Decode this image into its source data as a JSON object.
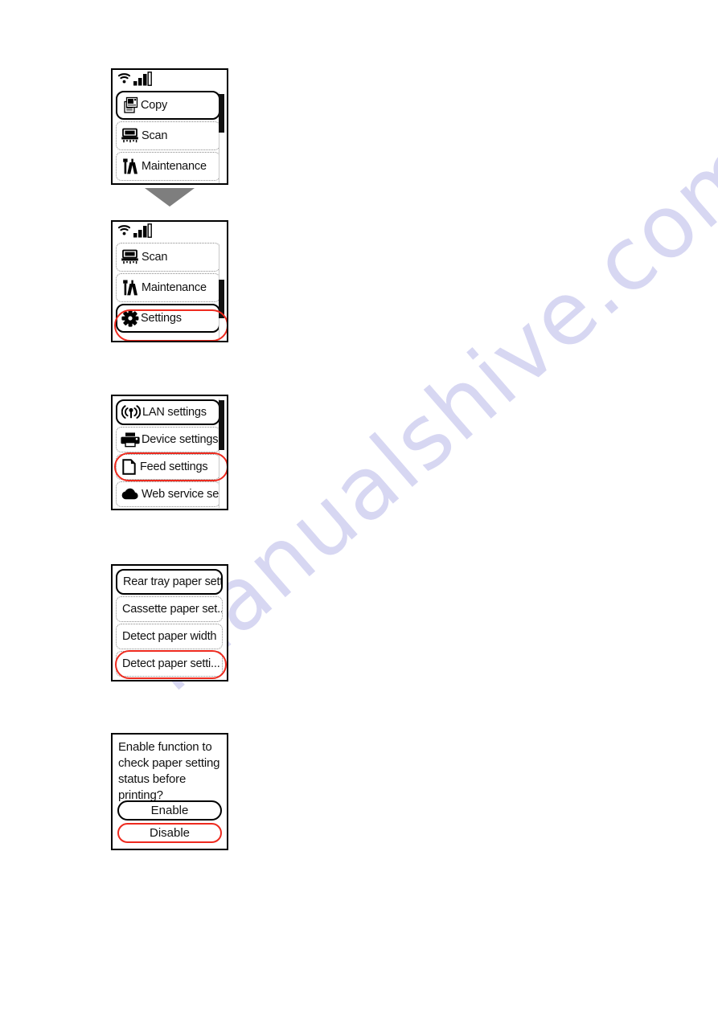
{
  "watermark": {
    "text": "manualshive.com"
  },
  "screens": [
    {
      "id": "home-screen-copy",
      "statusbar": {
        "wifi_icon": "wifi-icon",
        "signal_icon": "signal-bars-icon"
      },
      "scrollbar": {
        "visible": true,
        "thumb_position": "top"
      },
      "rows": [
        {
          "label": "Copy",
          "icon": "copy-icon",
          "selected": true,
          "highlight": "none"
        },
        {
          "label": "Scan",
          "icon": "scan-icon",
          "selected": false,
          "highlight": "none"
        },
        {
          "label": "Maintenance",
          "icon": "maintenance-icon",
          "selected": false,
          "highlight": "none"
        }
      ]
    },
    {
      "id": "home-screen-settings",
      "statusbar": {
        "wifi_icon": "wifi-icon",
        "signal_icon": "signal-bars-icon"
      },
      "scrollbar": {
        "visible": true,
        "thumb_position": "bottom"
      },
      "rows": [
        {
          "label": "Scan",
          "icon": "scan-icon",
          "selected": false,
          "highlight": "none"
        },
        {
          "label": "Maintenance",
          "icon": "maintenance-icon",
          "selected": false,
          "highlight": "none"
        },
        {
          "label": "Settings",
          "icon": "gear-icon",
          "selected": true,
          "highlight": "red"
        }
      ]
    },
    {
      "id": "settings-menu-screen",
      "statusbar": null,
      "scrollbar": {
        "visible": true,
        "thumb_position": "top"
      },
      "rows": [
        {
          "label": "LAN settings",
          "icon": "lan-antenna-icon",
          "selected": true,
          "highlight": "none"
        },
        {
          "label": "Device settings",
          "icon": "printer-icon",
          "selected": false,
          "highlight": "none"
        },
        {
          "label": "Feed settings",
          "icon": "paper-icon",
          "selected": false,
          "highlight": "red"
        },
        {
          "label": "Web service set...",
          "icon": "cloud-icon",
          "selected": false,
          "highlight": "none"
        }
      ]
    },
    {
      "id": "feed-settings-screen",
      "statusbar": null,
      "scrollbar": {
        "visible": false,
        "thumb_position": "none"
      },
      "rows": [
        {
          "label": "Rear tray paper sett",
          "icon": "none",
          "selected": true,
          "highlight": "none"
        },
        {
          "label": "Cassette paper set...",
          "icon": "none",
          "selected": false,
          "highlight": "none"
        },
        {
          "label": "Detect paper width",
          "icon": "none",
          "selected": false,
          "highlight": "none"
        },
        {
          "label": "Detect paper setti...",
          "icon": "none",
          "selected": false,
          "highlight": "red"
        }
      ]
    }
  ],
  "dialog": {
    "id": "detect-paper-setting-dialog",
    "message_lines": [
      "Enable function to",
      "check paper setting",
      "status before",
      "printing?"
    ],
    "buttons": [
      {
        "label": "Enable",
        "highlight": "black"
      },
      {
        "label": "Disable",
        "highlight": "red"
      }
    ]
  },
  "arrow": {
    "icon": "arrow-down-triangle-icon"
  },
  "colors": {
    "highlight_red": "#ee2a1e",
    "selection_black": "#000000",
    "arrow_gray": "#7e7e7e",
    "watermark": "#d7d7f2"
  }
}
